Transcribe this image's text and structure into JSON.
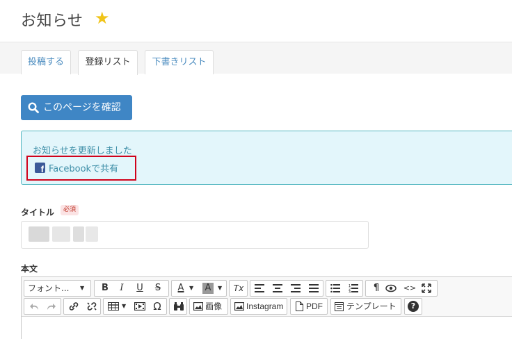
{
  "header": {
    "title": "お知らせ",
    "star": "★"
  },
  "tabs": [
    {
      "label": "投稿する",
      "active": false
    },
    {
      "label": "登録リスト",
      "active": true
    },
    {
      "label": "下書きリスト",
      "active": false
    }
  ],
  "confirm_button": {
    "label": "このページを確認",
    "icon": "search-icon"
  },
  "alert": {
    "message": "お知らせを更新しました",
    "share_label": "Facebookで共有",
    "share_icon": "facebook-icon",
    "fb_glyph": "f"
  },
  "form": {
    "title_label": "タイトル",
    "required": "必須",
    "body_label": "本文"
  },
  "toolbar": {
    "font_select": "フォント...",
    "bold": "B",
    "italic": "I",
    "underline": "U",
    "strike": "S",
    "text_color": "A",
    "bg_color": "A",
    "clear_format": "Tx",
    "pilcrow": "¶",
    "code": "<>",
    "omega": "Ω",
    "image_label": "画像",
    "instagram_label": "Instagram",
    "pdf_label": "PDF",
    "template_label": "テンプレート",
    "help": "?"
  },
  "colors": {
    "accent": "#3f86c5",
    "alert_bg": "#e3f6fb",
    "alert_border": "#52b6c0",
    "highlight_border": "#d0021b",
    "facebook": "#3b5998",
    "star": "#f0c419"
  }
}
